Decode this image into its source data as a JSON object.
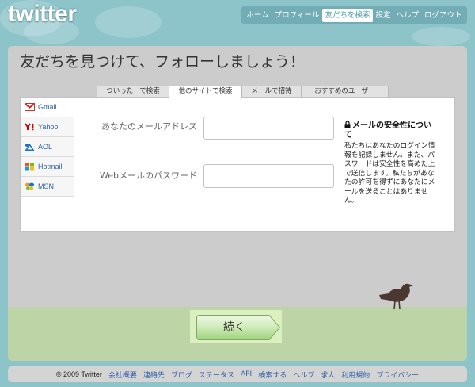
{
  "app": {
    "logo_text": "twitter"
  },
  "nav": {
    "items": [
      {
        "label": "ホーム",
        "active": false
      },
      {
        "label": "プロフィール",
        "active": false
      },
      {
        "label": "友だちを検索",
        "active": true
      },
      {
        "label": "設定",
        "active": false
      },
      {
        "label": "ヘルプ",
        "active": false
      },
      {
        "label": "ログアウト",
        "active": false
      }
    ]
  },
  "page": {
    "title": "友だちを見つけて、フォローしましょう！"
  },
  "tabs": [
    {
      "label": "ついったーで検索",
      "active": false
    },
    {
      "label": "他のサイトで検索",
      "active": true
    },
    {
      "label": "メールで招待",
      "active": false
    },
    {
      "label": "おすすめのユーザー",
      "active": false
    }
  ],
  "providers": [
    {
      "label": "Gmail",
      "icon": "gmail-icon",
      "selected": true
    },
    {
      "label": "Yahoo",
      "icon": "yahoo-icon",
      "selected": false
    },
    {
      "label": "AOL",
      "icon": "aol-icon",
      "selected": false
    },
    {
      "label": "Hotmail",
      "icon": "hotmail-icon",
      "selected": false
    },
    {
      "label": "MSN",
      "icon": "msn-icon",
      "selected": false
    }
  ],
  "form": {
    "email": {
      "label": "あなたのメールアドレス",
      "value": ""
    },
    "password": {
      "label": "Webメールのパスワード",
      "value": ""
    }
  },
  "security_note": {
    "icon": "lock-icon",
    "title": "メールの安全性について",
    "body": "私たちはあなたのログイン情報を記録しません。また、パスワードは安全性を高めた上で送信します。私たちがあなたの許可を得ずにあなたにメールを送ることはありません。"
  },
  "continue_button": {
    "label": "続く"
  },
  "decor": {
    "mascot": "bird-icon"
  },
  "footer": {
    "copyright": "© 2009 Twitter",
    "links": [
      "会社概要",
      "連絡先",
      "ブログ",
      "ステータス",
      "API",
      "検索する",
      "ヘルプ",
      "求人",
      "利用規約",
      "プライバシー"
    ]
  },
  "colors": {
    "background": "#8cc4ca",
    "panel": "#cccccc",
    "grass": "#bcd4a6",
    "link": "#2f62a8",
    "nav_background": "#72adb5",
    "button_green": "#9fd37c"
  }
}
